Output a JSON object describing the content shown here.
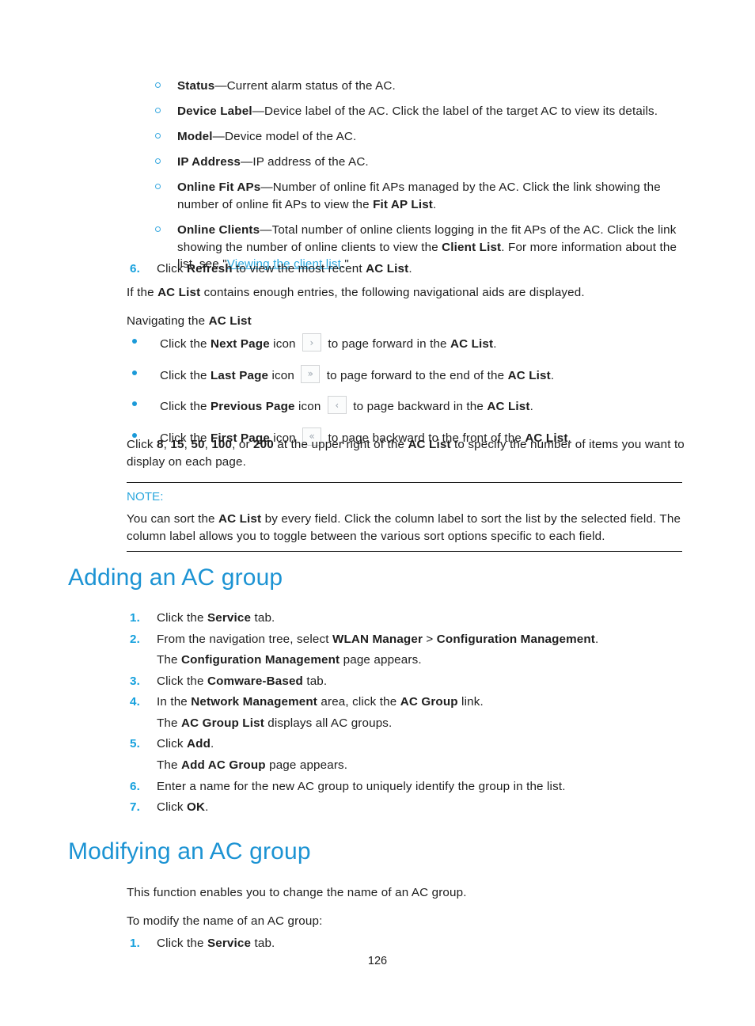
{
  "colors": {
    "heading": "#1c93d3",
    "accent": "#15a0dd",
    "link": "#2ba7dd",
    "bullet": "#1b9ad8",
    "text": "#1d1d1d",
    "icon_border": "#d2d4d6",
    "icon_glyph": "#9aa4ae"
  },
  "field_list": {
    "items": [
      {
        "term": "Status",
        "text": "—Current alarm status of the AC."
      },
      {
        "term": "Device Label",
        "text": "—Device label of the AC. Click the label of the target AC to view its details."
      },
      {
        "term": "Model",
        "text": "—Device model of the AC."
      },
      {
        "term": "IP Address",
        "text": "—IP address of the AC."
      },
      {
        "term": "Online Fit APs",
        "text_a": "—Number of online fit APs managed by the AC. Click the link showing the number of online fit APs to view the ",
        "bold_b": "Fit AP List",
        "text_c": "."
      },
      {
        "term": "Online Clients",
        "text_a": "—Total number of online clients logging in the fit APs of the AC. Click the link showing the number of online clients to view the ",
        "bold_b": "Client List",
        "text_c": ". For more information about the list, see \"",
        "link": "Viewing the client list",
        "text_d": ".\""
      }
    ]
  },
  "refresh_step": {
    "num": "6.",
    "text_a": "Click ",
    "bold_a": "Refresh",
    "text_b": " to view the most recent ",
    "bold_b": "AC List",
    "text_c": "."
  },
  "intro": {
    "line1_a": "If the ",
    "line1_bold": "AC List",
    "line1_b": " contains enough entries, the following navigational aids are displayed.",
    "line2_a": "Navigating the ",
    "line2_bold": "AC List"
  },
  "nav_aids": [
    {
      "text_a": "Click the ",
      "bold_a": "Next Page",
      "text_b": " icon ",
      "icon": "›",
      "icon_name": "next-page-icon",
      "text_c": " to page forward in the ",
      "bold_b": "AC List",
      "text_d": "."
    },
    {
      "text_a": "Click the ",
      "bold_a": "Last Page",
      "text_b": " icon ",
      "icon": "»",
      "icon_name": "last-page-icon",
      "text_c": " to page forward to the end of the ",
      "bold_b": "AC List",
      "text_d": "."
    },
    {
      "text_a": "Click the ",
      "bold_a": "Previous Page",
      "text_b": " icon ",
      "icon": "‹",
      "icon_name": "previous-page-icon",
      "text_c": " to page backward in the ",
      "bold_b": "AC List",
      "text_d": "."
    },
    {
      "text_a": "Click the ",
      "bold_a": "First Page",
      "text_b": " icon ",
      "icon": "«",
      "icon_name": "first-page-icon",
      "text_c": " to page backward to the front of the ",
      "bold_b": "AC List",
      "text_d": "."
    }
  ],
  "page_size": {
    "text_a": "Click ",
    "v1": "8",
    "sep1": ", ",
    "v2": "15",
    "sep2": ", ",
    "v3": "50",
    "sep3": ", ",
    "v4": "100",
    "sep4": ", or ",
    "v5": "200",
    "text_b": " at the upper right of the ",
    "bold_b": "AC List",
    "text_c": " to specify the number of items you want to display on each page."
  },
  "note": {
    "label": "NOTE:",
    "text_a": "You can sort the ",
    "bold_a": "AC List",
    "text_b": " by every field. Click the column label to sort the list by the selected field. The column label allows you to toggle between the various sort options specific to each field."
  },
  "adding_section": {
    "heading": "Adding an AC group",
    "steps": [
      {
        "num": "1.",
        "text_a": "Click the ",
        "bold_a": "Service",
        "text_b": " tab."
      },
      {
        "num": "2.",
        "text_a": "From the navigation tree, select ",
        "bold_a": "WLAN Manager",
        "text_b": " > ",
        "bold_b": "Configuration Management",
        "text_c": ".",
        "sub_a": "The ",
        "sub_bold": "Configuration Management",
        "sub_b": " page appears."
      },
      {
        "num": "3.",
        "text_a": "Click the ",
        "bold_a": "Comware-Based",
        "text_b": " tab."
      },
      {
        "num": "4.",
        "text_a": "In the ",
        "bold_a": "Network Management",
        "text_b": " area, click the ",
        "bold_b": "AC Group",
        "text_c": " link.",
        "sub_a": "The ",
        "sub_bold": "AC Group List",
        "sub_b": " displays all AC groups."
      },
      {
        "num": "5.",
        "text_a": "Click ",
        "bold_a": "Add",
        "text_b": ".",
        "sub_a": "The ",
        "sub_bold": "Add AC Group",
        "sub_b": " page appears."
      },
      {
        "num": "6.",
        "text_a": "Enter a name for the new AC group to uniquely identify the group in the list."
      },
      {
        "num": "7.",
        "text_a": "Click ",
        "bold_a": "OK",
        "text_b": "."
      }
    ]
  },
  "modifying_section": {
    "heading": "Modifying an AC group",
    "para1": "This function enables you to change the name of an AC group.",
    "para2": "To modify the name of an AC group:",
    "steps": [
      {
        "num": "1.",
        "text_a": "Click the ",
        "bold_a": "Service",
        "text_b": " tab."
      }
    ]
  },
  "footer": {
    "page_number": "126"
  }
}
